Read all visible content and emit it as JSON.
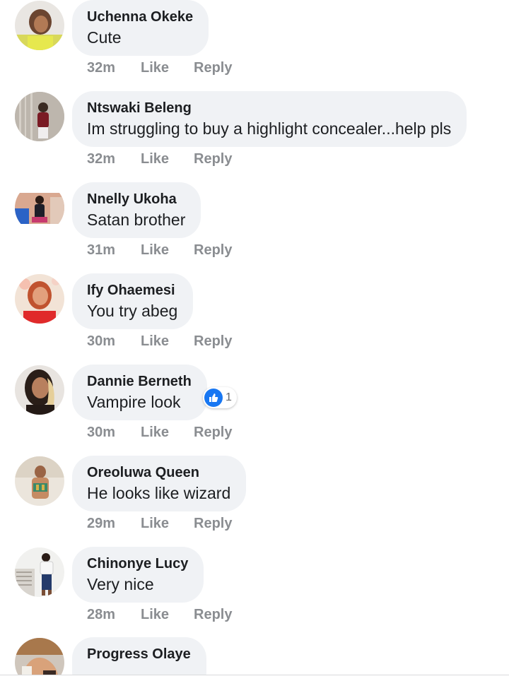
{
  "comments": [
    {
      "author": "Uchenna Okeke",
      "text": "Cute",
      "time": "32m",
      "like_label": "Like",
      "reply_label": "Reply"
    },
    {
      "author": "Ntswaki Beleng",
      "text": "Im struggling to buy a  highlight concealer...help pls",
      "time": "32m",
      "like_label": "Like",
      "reply_label": "Reply"
    },
    {
      "author": "Nnelly Ukoha",
      "text": "Satan brother",
      "time": "31m",
      "like_label": "Like",
      "reply_label": "Reply"
    },
    {
      "author": "Ify Ohaemesi",
      "text": "You try abeg",
      "time": "30m",
      "like_label": "Like",
      "reply_label": "Reply"
    },
    {
      "author": "Dannie Berneth",
      "text": "Vampire look",
      "time": "30m",
      "like_label": "Like",
      "reply_label": "Reply",
      "reactions": {
        "icon": "thumbs-up-icon",
        "count": "1"
      }
    },
    {
      "author": "Oreoluwa Queen",
      "text": "He looks like wizard",
      "time": "29m",
      "like_label": "Like",
      "reply_label": "Reply"
    },
    {
      "author": "Chinonye Lucy",
      "text": "Very nice",
      "time": "28m",
      "like_label": "Like",
      "reply_label": "Reply"
    },
    {
      "author": "Progress Olaye"
    }
  ],
  "colors": {
    "bubble": "#f0f2f5",
    "meta_text": "#8a8d91",
    "like_reaction": "#1877f2"
  }
}
